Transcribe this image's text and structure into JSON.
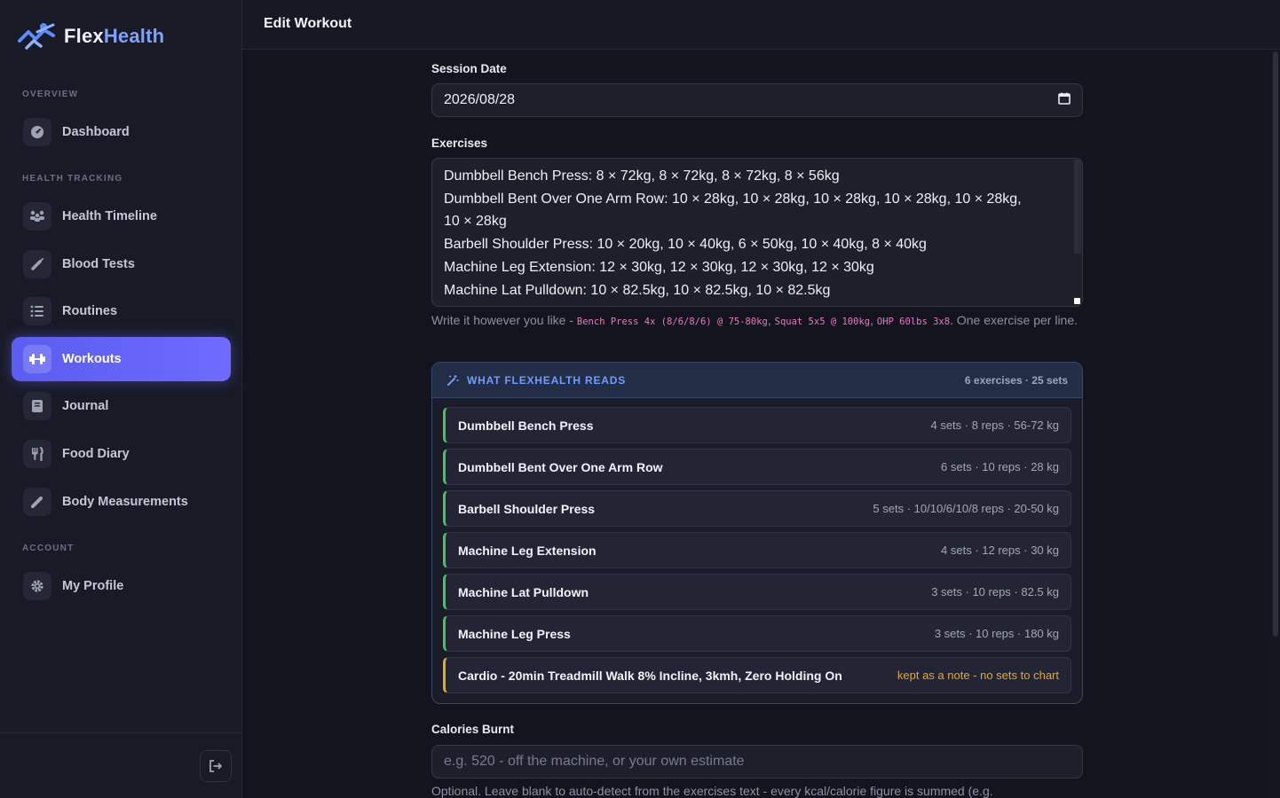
{
  "app": {
    "brand_part1": "Flex",
    "brand_part2": "Health"
  },
  "sidebar": {
    "sections": [
      {
        "label": "OVERVIEW"
      },
      {
        "label": "HEALTH TRACKING"
      },
      {
        "label": "ACCOUNT"
      }
    ],
    "items": [
      {
        "label": "Dashboard",
        "icon": "gauge-icon"
      },
      {
        "label": "Health Timeline",
        "icon": "people-icon"
      },
      {
        "label": "Blood Tests",
        "icon": "syringe-icon"
      },
      {
        "label": "Routines",
        "icon": "list-icon"
      },
      {
        "label": "Workouts",
        "icon": "dumbbell-icon",
        "active": true
      },
      {
        "label": "Journal",
        "icon": "book-icon"
      },
      {
        "label": "Food Diary",
        "icon": "utensils-icon"
      },
      {
        "label": "Body Measurements",
        "icon": "pencil-icon"
      },
      {
        "label": "My Profile",
        "icon": "gear-icon"
      }
    ],
    "logout_icon": "logout-icon"
  },
  "header": {
    "title": "Edit Workout"
  },
  "form": {
    "session_date_label": "Session Date",
    "session_date_value": "2026/08/28",
    "exercises_label": "Exercises",
    "exercise_lines": [
      "Dumbbell Bench Press: 8 × 72kg, 8 × 72kg, 8 × 72kg, 8 × 56kg",
      "Dumbbell Bent Over One Arm Row: 10 × 28kg, 10 × 28kg, 10 × 28kg, 10 × 28kg, 10 × 28kg,",
      "10 × 28kg",
      "Barbell Shoulder Press: 10 × 20kg, 10 × 40kg, 6 × 50kg, 10 × 40kg, 8 × 40kg",
      "Machine Leg Extension: 12 × 30kg, 12 × 30kg, 12 × 30kg, 12 × 30kg",
      "Machine Lat Pulldown: 10 × 82.5kg, 10 × 82.5kg, 10 × 82.5kg"
    ],
    "help_prefix": "Write it however you like - ",
    "help_example1": "Bench Press 4x (8/6/8/6) @ 75-80kg",
    "help_sep1": ", ",
    "help_example2": "Squat 5x5 @ 100kg",
    "help_sep2": ", ",
    "help_example3": "OHP 60lbs 3x8",
    "help_suffix": ". One exercise per line.",
    "calories_label": "Calories Burnt",
    "calories_placeholder": "e.g. 520 - off the machine, or your own estimate",
    "calories_help": "Optional. Leave blank to auto-detect from the exercises text - every kcal/calorie figure is summed (e.g."
  },
  "reads": {
    "title": "WHAT FLEXHEALTH READS",
    "count": "6 exercises · 25 sets",
    "exercises": [
      {
        "name": "Dumbbell Bench Press",
        "meta": "4 sets · 8 reps · 56-72 kg",
        "type": "parsed"
      },
      {
        "name": "Dumbbell Bent Over One Arm Row",
        "meta": "6 sets · 10 reps · 28 kg",
        "type": "parsed"
      },
      {
        "name": "Barbell Shoulder Press",
        "meta": "5 sets · 10/10/6/10/8 reps · 20-50 kg",
        "type": "parsed"
      },
      {
        "name": "Machine Leg Extension",
        "meta": "4 sets · 12 reps · 30 kg",
        "type": "parsed"
      },
      {
        "name": "Machine Lat Pulldown",
        "meta": "3 sets · 10 reps · 82.5 kg",
        "type": "parsed"
      },
      {
        "name": "Machine Leg Press",
        "meta": "3 sets · 10 reps · 180 kg",
        "type": "parsed"
      },
      {
        "name": "Cardio - 20min Treadmill Walk 8% Incline, 3kmh, Zero Holding On",
        "meta": "kept as a note - no sets to chart",
        "type": "note"
      }
    ]
  },
  "colors": {
    "accent": "#6366f1",
    "parsed": "#48c35b",
    "note": "#e5a92a",
    "link": "#6f9dff"
  }
}
